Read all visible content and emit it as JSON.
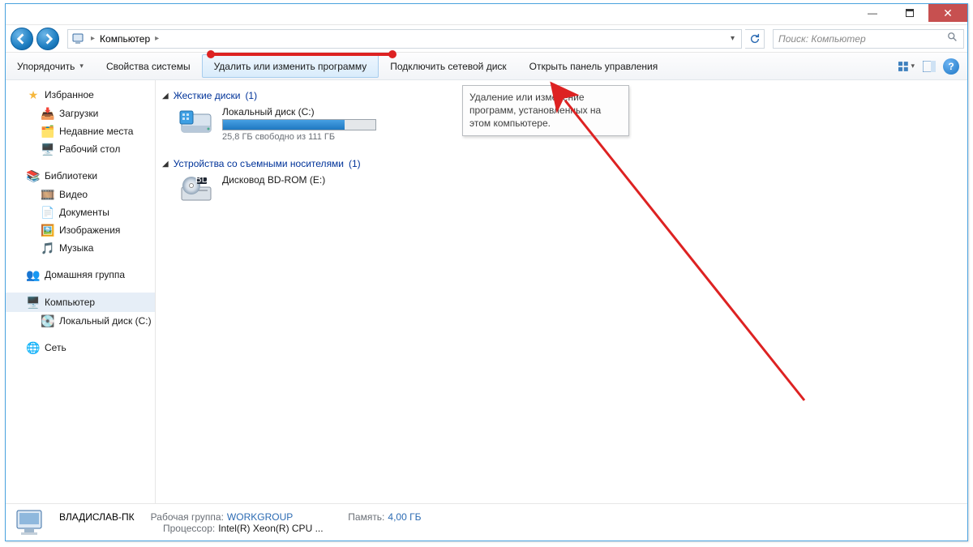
{
  "breadcrumb": {
    "location": "Компьютер"
  },
  "search": {
    "placeholder": "Поиск: Компьютер"
  },
  "toolbar": {
    "organize": "Упорядочить",
    "system_props": "Свойства системы",
    "uninstall": "Удалить или изменить программу",
    "map_drive": "Подключить сетевой диск",
    "control_panel": "Открыть панель управления"
  },
  "sidebar": {
    "favorites": {
      "header": "Избранное",
      "items": [
        "Загрузки",
        "Недавние места",
        "Рабочий стол"
      ]
    },
    "libraries": {
      "header": "Библиотеки",
      "items": [
        "Видео",
        "Документы",
        "Изображения",
        "Музыка"
      ]
    },
    "homegroup": "Домашняя группа",
    "computer": {
      "header": "Компьютер",
      "items": [
        "Локальный диск (C:)"
      ]
    },
    "network": "Сеть"
  },
  "main": {
    "hdd": {
      "title": "Жесткие диски",
      "count": "(1)",
      "drive_label": "Локальный диск (C:)",
      "capacity_text": "25,8 ГБ свободно из 111 ГБ"
    },
    "removable": {
      "title": "Устройства со съемными носителями",
      "count": "(1)",
      "drive_label": "Дисковод BD-ROM (E:)"
    }
  },
  "tooltip": {
    "text": "Удаление или изменение программ, установленных на этом компьютере."
  },
  "status": {
    "hostname": "ВЛАДИСЛАВ-ПК",
    "workgroup_label": "Рабочая группа:",
    "workgroup_value": "WORKGROUP",
    "cpu_label": "Процессор:",
    "cpu_value": "Intel(R) Xeon(R) CPU    ...",
    "mem_label": "Память:",
    "mem_value": "4,00 ГБ"
  }
}
